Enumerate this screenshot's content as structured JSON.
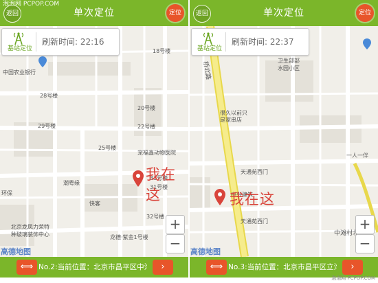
{
  "header": {
    "watermark": "泡泡网 PCPOP.COM",
    "title": "单次定位",
    "back_label": "返回",
    "locate_label": "定位"
  },
  "panels": [
    {
      "refresh_label": "刷新时间:",
      "refresh_time": "22:16",
      "station_label": "基站定位",
      "me_label": "我在这",
      "address": "No.2:当前位置：北京市昌平区中沟",
      "map_labels": [
        "18号楼",
        "中国农业银行",
        "28号楼",
        "20号楼",
        "29号楼",
        "22号楼",
        "25号楼",
        "宠福鑫动物医院",
        "33号楼",
        "31号楼",
        "快客",
        "32号楼",
        "北京龙凤力荣特",
        "种玻璃装饰中心",
        "龙德·紫金1号楼",
        "潮粤缘",
        "环保"
      ],
      "map_logo": "高德地图"
    },
    {
      "refresh_label": "刷新时间:",
      "refresh_time": "22:37",
      "station_label": "基站定位",
      "me_label": "我在这",
      "address": "No.3:当前位置：北京市昌平区立沟",
      "map_labels": [
        "桥北路",
        "卫生部部",
        "水园小区",
        "很久以前只",
        "是家串店",
        "天通苑西门",
        "中兴建筑",
        "天通苑西门",
        "一人一伴",
        "中滩村北"
      ],
      "map_logo": "高德地图"
    }
  ],
  "zoom": {
    "in": "+",
    "out": "−"
  },
  "arrows": {
    "swap": "⟺",
    "next": "›"
  },
  "footer": "泡泡网 PCPOP.COM",
  "colors": {
    "accent_green": "#7bb62a",
    "accent_orange": "#e8552a",
    "pin_red": "#d9443b"
  }
}
